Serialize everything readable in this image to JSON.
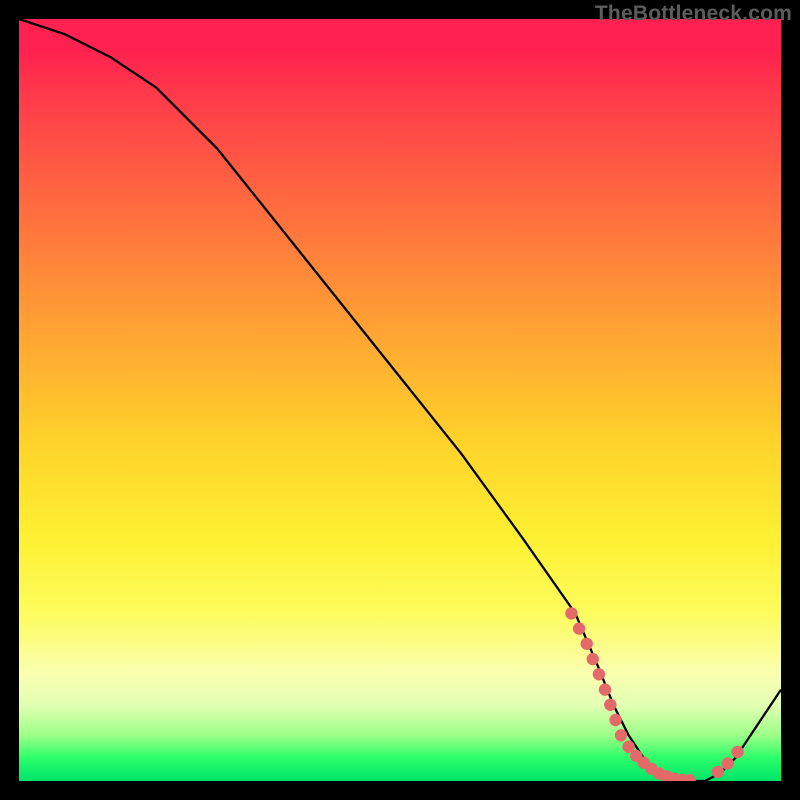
{
  "watermark": "TheBottleneck.com",
  "chart_data": {
    "type": "line",
    "title": "",
    "xlabel": "",
    "ylabel": "",
    "xlim": [
      0,
      100
    ],
    "ylim": [
      0,
      100
    ],
    "series": [
      {
        "name": "bottleneck-curve",
        "x": [
          0,
          6,
          12,
          18,
          26,
          34,
          42,
          50,
          58,
          66,
          73,
          76,
          78,
          80,
          82,
          84,
          86,
          88,
          90,
          92,
          94,
          100
        ],
        "y": [
          100,
          98,
          95,
          91,
          83,
          73,
          63,
          53,
          43,
          32,
          22,
          15,
          10,
          6,
          3,
          1,
          0,
          0,
          0,
          1,
          3,
          12
        ]
      }
    ],
    "markers": {
      "name": "highlight-dots",
      "x": [
        72.5,
        73.5,
        74.5,
        75.3,
        76.1,
        76.9,
        77.6,
        78.3,
        79.0,
        80.0,
        81.0,
        82.0,
        83.0,
        84.0,
        85.0,
        86.0,
        87.0,
        88.0,
        91.7,
        93.0,
        94.3
      ],
      "y": [
        22.0,
        20.0,
        18.0,
        16.0,
        14.0,
        12.0,
        10.0,
        8.0,
        6.0,
        4.5,
        3.3,
        2.4,
        1.6,
        1.0,
        0.6,
        0.3,
        0.15,
        0.1,
        1.2,
        2.3,
        3.8
      ]
    }
  }
}
